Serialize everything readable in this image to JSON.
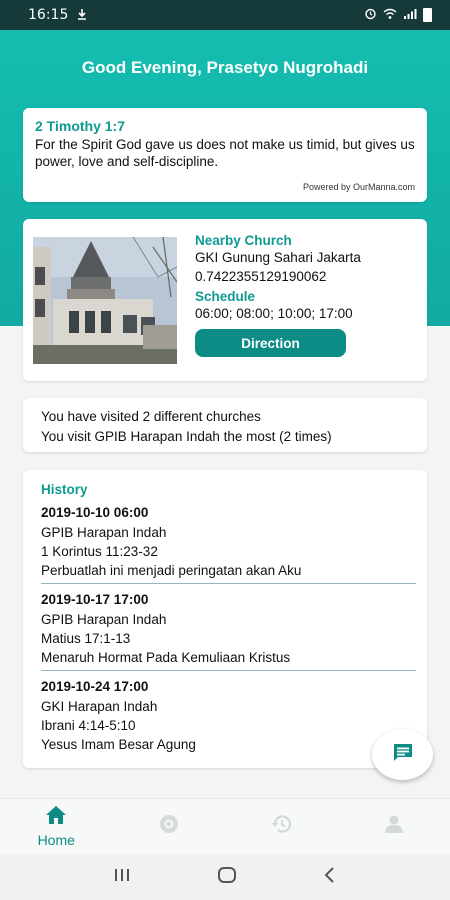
{
  "status_bar": {
    "time": "16:15"
  },
  "header": {
    "greeting": "Good Evening, Prasetyo Nugrohadi"
  },
  "verse": {
    "reference": "2 Timothy 1:7",
    "text": "For the Spirit God gave us does not make us timid, but gives us power, love and self-discipline.",
    "powered_by": "Powered by OurManna.com"
  },
  "church": {
    "nearby_label": "Nearby Church",
    "name": "GKI Gunung Sahari Jakarta",
    "distance": "0.7422355129190062",
    "schedule_label": "Schedule",
    "schedule": "06:00; 08:00; 10:00; 17:00",
    "direction_label": "Direction"
  },
  "visits": {
    "line1": "You have visited 2 different churches",
    "line2": "You visit GPIB Harapan Indah the most (2 times)"
  },
  "history": {
    "title": "History",
    "entries": [
      {
        "date": "2019-10-10 06:00",
        "church": "GPIB Harapan Indah",
        "passage": "1 Korintus 11:23-32",
        "theme": "Perbuatlah ini menjadi peringatan akan Aku"
      },
      {
        "date": "2019-10-17 17:00",
        "church": "GPIB Harapan Indah",
        "passage": "Matius 17:1-13",
        "theme": "Menaruh Hormat Pada Kemuliaan Kristus"
      },
      {
        "date": "2019-10-24 17:00",
        "church": "GKI Harapan Indah",
        "passage": "Ibrani 4:14-5:10",
        "theme": "Yesus Imam Besar Agung"
      }
    ]
  },
  "bottom_nav": {
    "home_label": "Home",
    "icons": [
      "home-icon",
      "eye-icon",
      "history-icon",
      "person-icon"
    ]
  },
  "colors": {
    "accent": "#12aaa2",
    "accent_dark": "#0d8c86",
    "status_bar": "#16393a"
  }
}
